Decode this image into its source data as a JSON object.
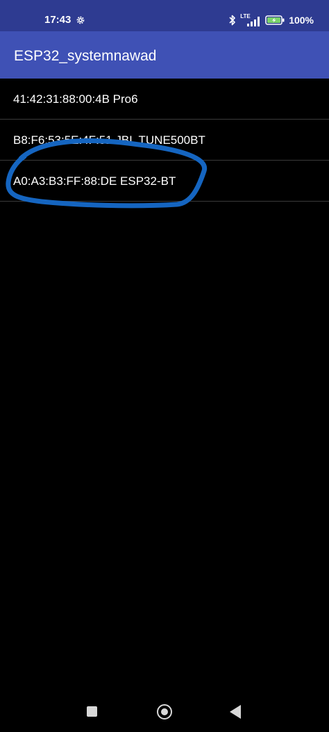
{
  "status_bar": {
    "time": "17:43",
    "network": "LTE",
    "battery": "100%",
    "icons": [
      "gear-icon",
      "bluetooth-icon",
      "lte-signal-icon",
      "battery-charging-icon"
    ]
  },
  "app_bar": {
    "title": "ESP32_systemnawad"
  },
  "devices": [
    "41:42:31:88:00:4B Pro6",
    "B8:F6:53:5E:4F:51 JBL TUNE500BT",
    "A0:A3:B3:FF:88:DE ESP32-BT"
  ],
  "annotation": {
    "type": "hand-drawn circle",
    "color": "#1565c0",
    "circled_device_index": 2
  },
  "nav_bar": {
    "buttons": [
      "recents-button",
      "home-button",
      "back-button"
    ]
  },
  "colors": {
    "status_bar": "#2e3b91",
    "app_bar": "#3f51b5",
    "background": "#000000",
    "divider": "#3a3a3a",
    "battery_accent": "#7ad36b"
  }
}
